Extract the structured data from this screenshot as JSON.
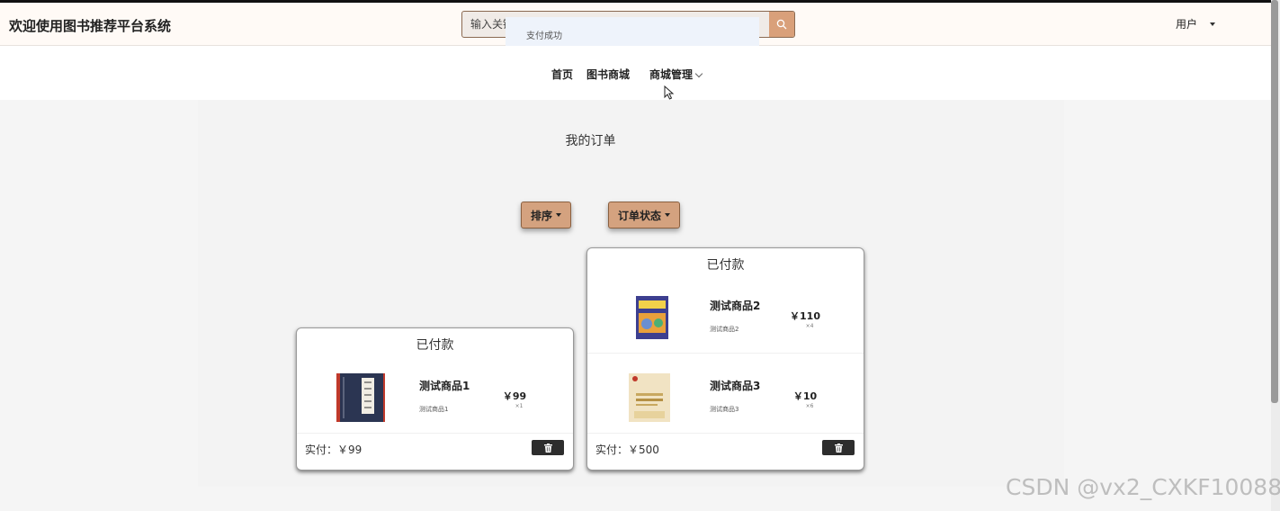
{
  "header": {
    "title": "欢迎使用图书推荐平台系统",
    "search_placeholder": "输入关键",
    "toast": "支付成功",
    "user_label": "用户"
  },
  "nav": {
    "items": [
      {
        "label": "首页"
      },
      {
        "label": "图书商城"
      },
      {
        "label": "商城管理"
      }
    ]
  },
  "page": {
    "title": "我的订单",
    "sort_label": "排序",
    "status_label": "订单状态"
  },
  "orders": [
    {
      "status": "已付款",
      "items": [
        {
          "name": "测试商品1",
          "desc": "测试商品1",
          "price": "￥99",
          "qty": "×1"
        }
      ],
      "total": "实付：￥99"
    },
    {
      "status": "已付款",
      "items": [
        {
          "name": "测试商品2",
          "desc": "测试商品2",
          "price": "￥110",
          "qty": "×4"
        },
        {
          "name": "测试商品3",
          "desc": "测试商品3",
          "price": "￥10",
          "qty": "×6"
        }
      ],
      "total": "实付：￥500"
    }
  ],
  "watermark": "CSDN @vx2_CXKF10088",
  "colors": {
    "accent": "#d4a27f",
    "delete_button": "#2d2d2d",
    "toast_bg": "#eef3fb"
  },
  "icons": [
    "search-icon",
    "chevron-down-icon",
    "caret-down-icon",
    "trash-icon",
    "book-cover-image"
  ]
}
